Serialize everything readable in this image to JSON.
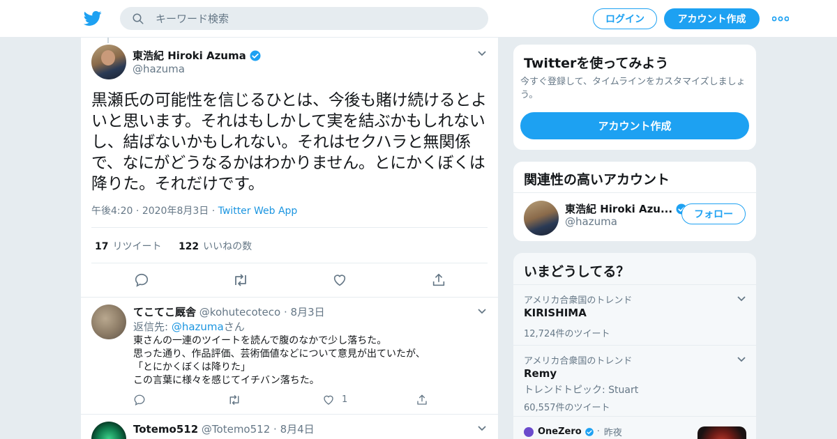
{
  "header": {
    "search_placeholder": "キーワード検索",
    "login_label": "ログイン",
    "signup_label": "アカウント作成"
  },
  "tweet": {
    "name": "東浩紀 Hiroki Azuma",
    "handle": "@hazuma",
    "text": "黒瀬氏の可能性を信じるひとは、今後も賭け続けるとよいと思います。それはもしかして実を結ぶかもしれないし、結ばないかもしれない。それはセクハラと無関係で、なにがどうなるかはわかりません。とにかくぼくは降りた。それだけです。",
    "time": "午後4:20",
    "date": "2020年8月3日",
    "source": "Twitter Web App",
    "retweets": "17",
    "retweets_label": "リツイート",
    "likes": "122",
    "likes_label": "いいねの数"
  },
  "replies": [
    {
      "name": "てこてこ厩舎",
      "handle": "@kohutecoteco",
      "date": "8月3日",
      "reply_prefix": "返信先: ",
      "reply_to": "@hazuma",
      "reply_suffix": "さん",
      "lines": [
        "東さんの一連のツイートを読んで腹のなかで少し落ちた。",
        "思った通り、作品評価、芸術価値などについて意見が出ていたが、",
        "「とにかくぼくは降りた」",
        "この言葉に様々を感じてイチバン落ちた。"
      ],
      "like_count": "1"
    },
    {
      "name": "Totemo512",
      "handle": "@Totemo512",
      "date": "8月4日"
    }
  ],
  "sidebar": {
    "signup_card": {
      "title": "Twitterを使ってみよう",
      "subtitle": "今すぐ登録して、タイムラインをカスタマイズしましょう。",
      "button": "アカウント作成"
    },
    "related": {
      "title": "関連性の高いアカウント",
      "name": "東浩紀 Hiroki Azu...",
      "handle": "@hazuma",
      "follow_label": "フォロー"
    },
    "trends": {
      "title": "いまどうしてる？",
      "items": [
        {
          "context": "アメリカ合衆国のトレンド",
          "name": "KIRISHIMA",
          "extra": "",
          "count": "12,724件のツイート"
        },
        {
          "context": "アメリカ合衆国のトレンド",
          "name": "Remy",
          "extra": "トレンドトピック: Stuart",
          "count": "60,557件のツイート"
        }
      ],
      "news": {
        "source": "OneZero",
        "time": "昨夜"
      }
    }
  },
  "colors": {
    "accent": "#1da1f2",
    "link": "#1b95e0",
    "muted": "#657786",
    "bg": "#e6ecf0"
  }
}
